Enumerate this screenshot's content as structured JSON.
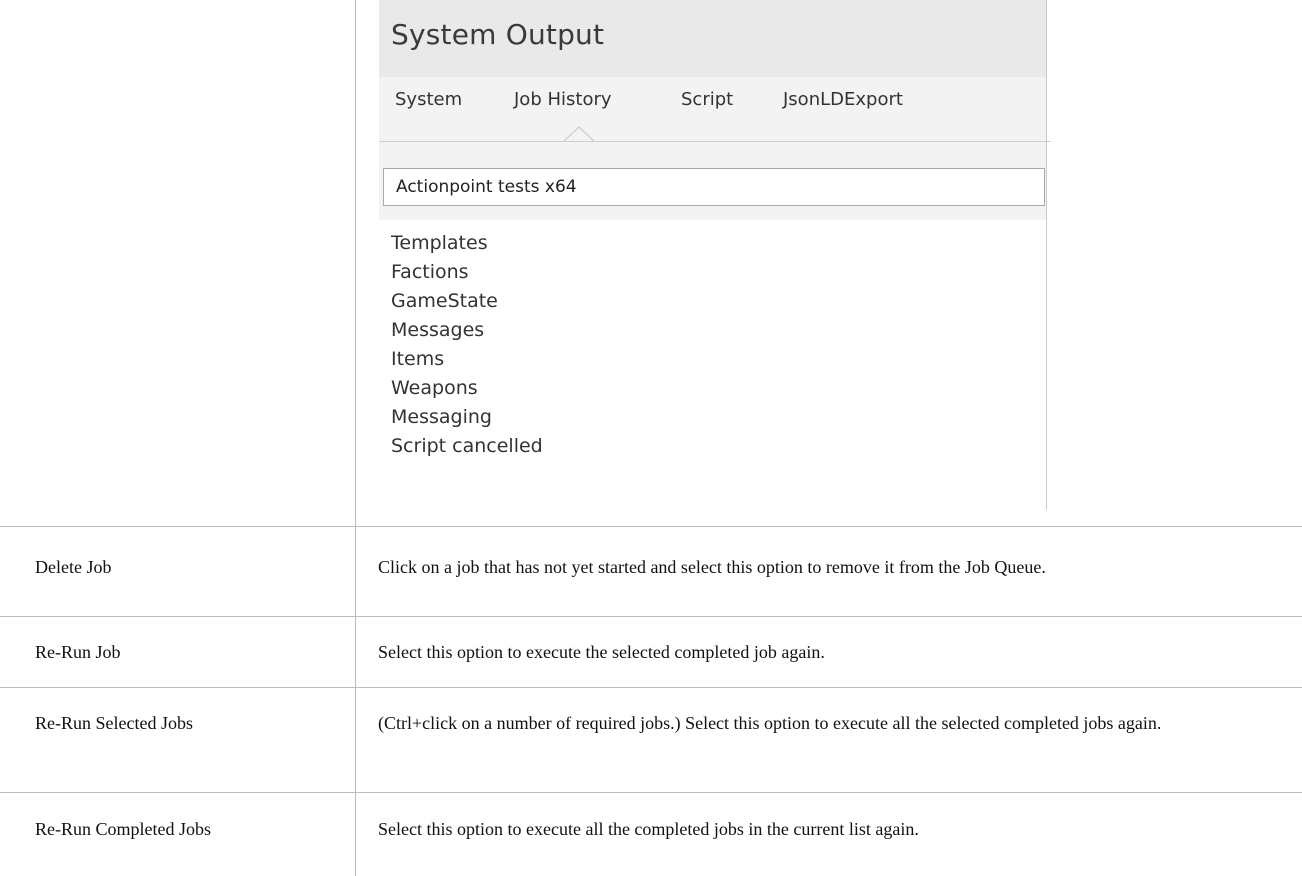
{
  "panel": {
    "title": "System Output",
    "tabs": [
      "System",
      "Job History",
      "Script",
      "JsonLDExport"
    ],
    "active_tab": "Job History",
    "job_selector_value": "Actionpoint tests x64",
    "output_lines": [
      "Templates",
      "Factions",
      "GameState",
      "Messages",
      "Items",
      "Weapons",
      "Messaging",
      "Script cancelled"
    ]
  },
  "rows": [
    {
      "option": "Delete Job",
      "description": "Click on a job that has not yet started and select this option to remove it from the Job Queue."
    },
    {
      "option": "Re-Run Job",
      "description": "Select this option to execute the selected completed job again."
    },
    {
      "option": "Re-Run Selected Jobs",
      "description": "(Ctrl+click on a number of required jobs.) Select this option to execute all the selected completed jobs again."
    },
    {
      "option": "Re-Run Completed Jobs",
      "description": "Select this option to execute all the completed jobs in the current list again."
    }
  ]
}
